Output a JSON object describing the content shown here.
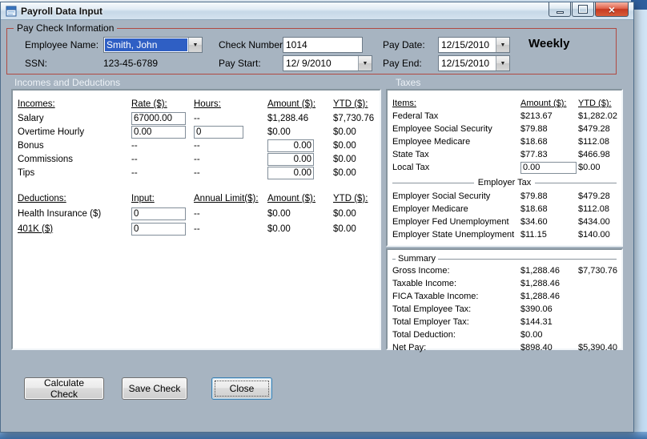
{
  "colors": {
    "form_background": "#a7b4c1",
    "selection_blue": "#2f5fc4",
    "groupbox_border_red": "#b04a42",
    "section_label_text": "#ecf1f6",
    "close_button_red": "#c53a22"
  },
  "icons": {
    "dropdown": "▼",
    "close": "×"
  },
  "window": {
    "title": "Payroll Data Input"
  },
  "paycheck": {
    "group_label": "Pay Check Information",
    "employee_name": {
      "label": "Employee Name:",
      "value": "Smith, John"
    },
    "ssn": {
      "label": "SSN:",
      "value": "123-45-6789"
    },
    "check_number": {
      "label": "Check Number:",
      "value": "1014"
    },
    "pay_start": {
      "label": "Pay Start:",
      "value": "12/ 9/2010"
    },
    "pay_date": {
      "label": "Pay Date:",
      "value": "12/15/2010"
    },
    "pay_end": {
      "label": "Pay End:",
      "value": "12/15/2010"
    },
    "frequency": "Weekly"
  },
  "sections": {
    "left": "Incomes and Deductions",
    "right": "Taxes"
  },
  "incomes": {
    "headers": {
      "name": "Incomes:",
      "rate": "Rate ($):",
      "hours": "Hours:",
      "amount": "Amount ($):",
      "ytd": "YTD ($):"
    },
    "rows": [
      {
        "name": "Salary",
        "rate": "67000.00",
        "hours": "--",
        "amount": "$1,288.46",
        "ytd": "$7,730.76"
      },
      {
        "name": "Overtime Hourly",
        "rate": "0.00",
        "hours": "0",
        "amount": "$0.00",
        "ytd": "$0.00"
      },
      {
        "name": "Bonus",
        "rate": "--",
        "hours": "--",
        "amount": "0.00",
        "ytd": "$0.00"
      },
      {
        "name": "Commissions",
        "rate": "--",
        "hours": "--",
        "amount": "0.00",
        "ytd": "$0.00"
      },
      {
        "name": "Tips",
        "rate": "--",
        "hours": "--",
        "amount": "0.00",
        "ytd": "$0.00"
      }
    ]
  },
  "deductions": {
    "headers": {
      "name": "Deductions:",
      "input": "Input:",
      "limit": "Annual Limit($):",
      "amount": "Amount ($):",
      "ytd": "YTD ($):"
    },
    "rows": [
      {
        "name": "Health Insurance  ($)",
        "input": "0",
        "limit": "--",
        "amount": "$0.00",
        "ytd": "$0.00"
      },
      {
        "name": "401K  ($)",
        "input": "0",
        "limit": "--",
        "amount": "$0.00",
        "ytd": "$0.00"
      }
    ]
  },
  "taxes": {
    "headers": {
      "items": "Items:",
      "amount": "Amount ($):",
      "ytd": "YTD ($):"
    },
    "rows": [
      {
        "name": "Federal Tax",
        "amount": "$213.67",
        "ytd": "$1,282.02"
      },
      {
        "name": "Employee Social Security",
        "amount": "$79.88",
        "ytd": "$479.28"
      },
      {
        "name": "Employee Medicare",
        "amount": "$18.68",
        "ytd": "$112.08"
      },
      {
        "name": "State Tax",
        "amount": "$77.83",
        "ytd": "$466.98"
      },
      {
        "name": "Local Tax",
        "amount": "0.00",
        "ytd": "$0.00"
      }
    ],
    "employer_group_label": "Employer Tax",
    "employer_rows": [
      {
        "name": "Employer Social Security",
        "amount": "$79.88",
        "ytd": "$479.28"
      },
      {
        "name": "Employer Medicare",
        "amount": "$18.68",
        "ytd": "$112.08"
      },
      {
        "name": "Employer Fed Unemployment",
        "amount": "$34.60",
        "ytd": "$434.00"
      },
      {
        "name": "Employer State Unemployment",
        "amount": "$11.15",
        "ytd": "$140.00"
      }
    ]
  },
  "summary": {
    "group_label": "Summary",
    "rows": [
      {
        "label": "Gross Income:",
        "amount": "$1,288.46",
        "ytd": "$7,730.76"
      },
      {
        "label": "Taxable Income:",
        "amount": "$1,288.46",
        "ytd": ""
      },
      {
        "label": "FICA Taxable Income:",
        "amount": "$1,288.46",
        "ytd": ""
      },
      {
        "label": "Total Employee Tax:",
        "amount": "$390.06",
        "ytd": ""
      },
      {
        "label": "Total Employer Tax:",
        "amount": "$144.31",
        "ytd": ""
      },
      {
        "label": "Total Deduction:",
        "amount": "$0.00",
        "ytd": ""
      },
      {
        "label": "Net Pay:",
        "amount": "$898.40",
        "ytd": "$5,390.40"
      }
    ]
  },
  "buttons": {
    "calculate": "Calculate Check",
    "save": "Save Check",
    "close": "Close"
  }
}
